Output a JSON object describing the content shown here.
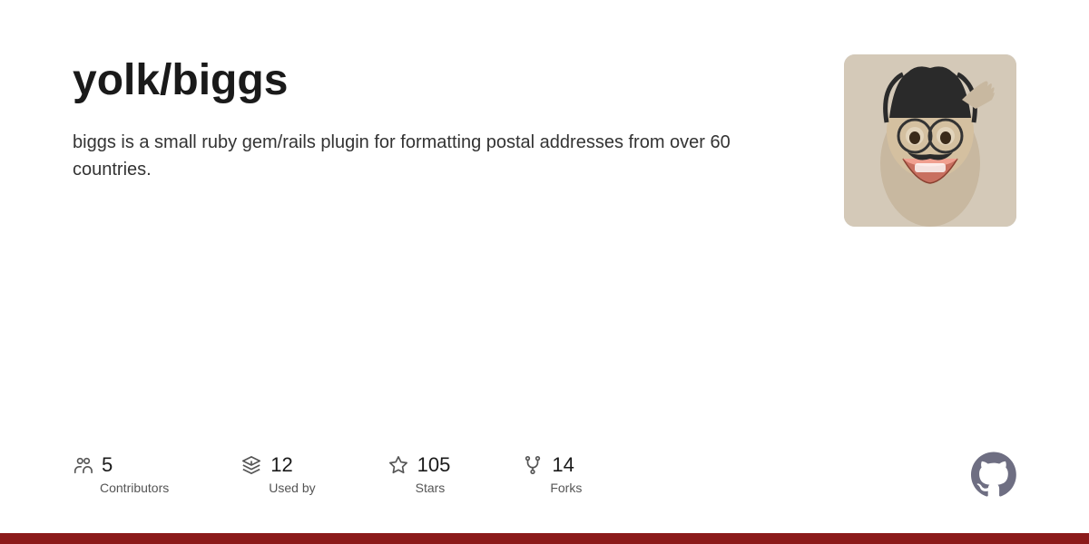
{
  "repo": {
    "owner": "yolk/",
    "name": "biggs",
    "description": "biggs is a small ruby gem/rails plugin for formatting postal addresses from over 60 countries."
  },
  "stats": {
    "contributors": {
      "count": "5",
      "label": "Contributors"
    },
    "used_by": {
      "count": "12",
      "label": "Used by"
    },
    "stars": {
      "count": "105",
      "label": "Stars"
    },
    "forks": {
      "count": "14",
      "label": "Forks"
    }
  },
  "bottom_bar": {
    "color": "#8b1a1a"
  }
}
